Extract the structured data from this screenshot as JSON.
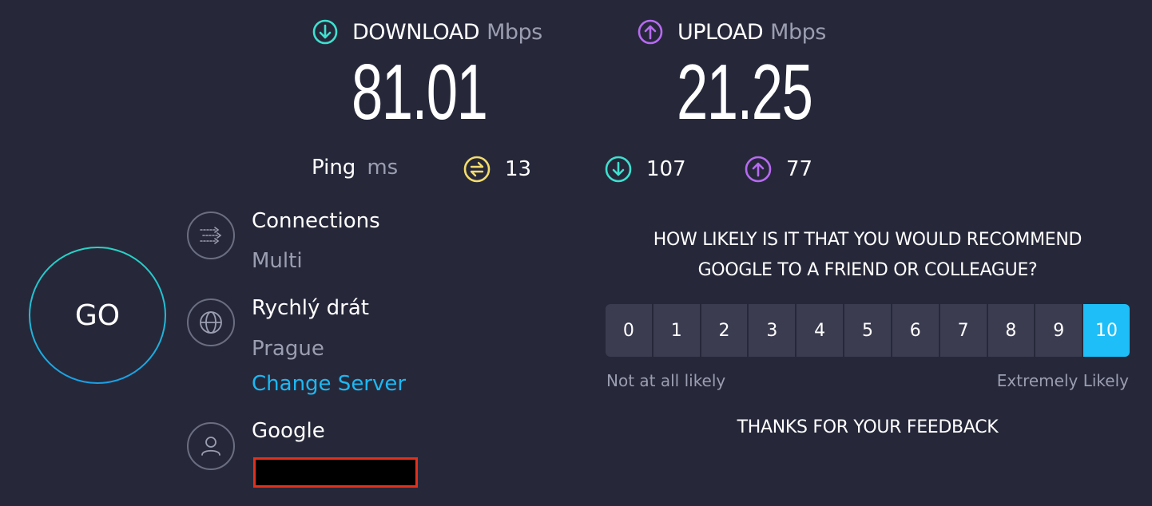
{
  "download": {
    "label": "DOWNLOAD",
    "unit": "Mbps",
    "value": "81.01",
    "icon": "arrow-down-circle-icon",
    "color": "#3ee0cf"
  },
  "upload": {
    "label": "UPLOAD",
    "unit": "Mbps",
    "value": "21.25",
    "icon": "arrow-up-circle-icon",
    "color": "#b76af0"
  },
  "ping": {
    "label": "Ping",
    "unit": "ms",
    "idle": {
      "value": "13",
      "icon": "ping-jitter-icon",
      "color": "#f3dc6b"
    },
    "download": {
      "value": "107",
      "icon": "arrow-down-circle-icon",
      "color": "#3ee0cf"
    },
    "upload": {
      "value": "77",
      "icon": "arrow-up-circle-icon",
      "color": "#b76af0"
    }
  },
  "go_button": {
    "label": "GO"
  },
  "connections": {
    "title": "Connections",
    "value": "Multi",
    "icon": "connections-arrows-icon"
  },
  "server": {
    "title": "Rychlý drát",
    "location": "Prague",
    "change_label": "Change Server",
    "icon": "globe-icon"
  },
  "provider": {
    "title": "Google",
    "icon": "user-icon"
  },
  "survey": {
    "question_line1": "HOW LIKELY IS IT THAT YOU WOULD RECOMMEND",
    "question_line2": "GOOGLE TO A FRIEND OR COLLEAGUE?",
    "options": [
      "0",
      "1",
      "2",
      "3",
      "4",
      "5",
      "6",
      "7",
      "8",
      "9",
      "10"
    ],
    "selected": "10",
    "low_label": "Not at all likely",
    "high_label": "Extremely Likely",
    "thanks": "THANKS FOR YOUR FEEDBACK",
    "accent": "#1ebef8"
  }
}
